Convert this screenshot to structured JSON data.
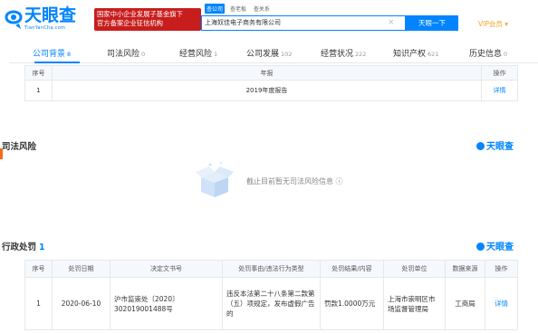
{
  "header": {
    "logo_text": "天眼查",
    "logo_sub": "TianYanCha.com",
    "gov_badge_line1": "国家中小企业发展子基金旗下",
    "gov_badge_line2": "官方备案企业征信机构",
    "search_tabs": [
      "查公司",
      "查老板",
      "查关系"
    ],
    "search_value": "上海奴佳电子商务有限公司",
    "search_button": "天眼一下",
    "vip_label": "VIP会员 ▾"
  },
  "tabs": [
    {
      "label": "公司背景",
      "count": "8"
    },
    {
      "label": "司法风险",
      "count": "0"
    },
    {
      "label": "经营风险",
      "count": "1"
    },
    {
      "label": "公司发展",
      "count": "102"
    },
    {
      "label": "经营状况",
      "count": "222"
    },
    {
      "label": "知识产权",
      "count": "621"
    },
    {
      "label": "历史信息",
      "count": "0"
    }
  ],
  "annual_report": {
    "headers": [
      "序号",
      "年报",
      "操作"
    ],
    "rows": [
      {
        "index": "1",
        "report": "2019年度报告",
        "action": "详情"
      }
    ]
  },
  "judicial": {
    "title": "司法风险",
    "brand": "天眼查",
    "empty_text": "截止目前暂无司法风险信息 ⓘ"
  },
  "penalty": {
    "title": "行政处罚",
    "count": "1",
    "brand": "天眼查",
    "headers": [
      "序号",
      "处罚日期",
      "决定文书号",
      "处罚事由/违法行为类型",
      "处罚结果/内容",
      "处罚单位",
      "数据来源",
      "操作"
    ],
    "rows": [
      {
        "index": "1",
        "date": "2020-06-10",
        "doc_no": "沪市监崇处〔2020〕302019001488号",
        "reason": "违反本法第二十八条第二款第（五）项规定，发布虚假广告的",
        "result": "罚款1.0000万元",
        "unit": "上海市崇明区市场监督管理局",
        "source": "工商局",
        "action": "详情"
      }
    ]
  },
  "colors": {
    "brand_blue": "#0084ff",
    "gov_red": "#c81d1d",
    "vip_orange": "#f5a623"
  }
}
